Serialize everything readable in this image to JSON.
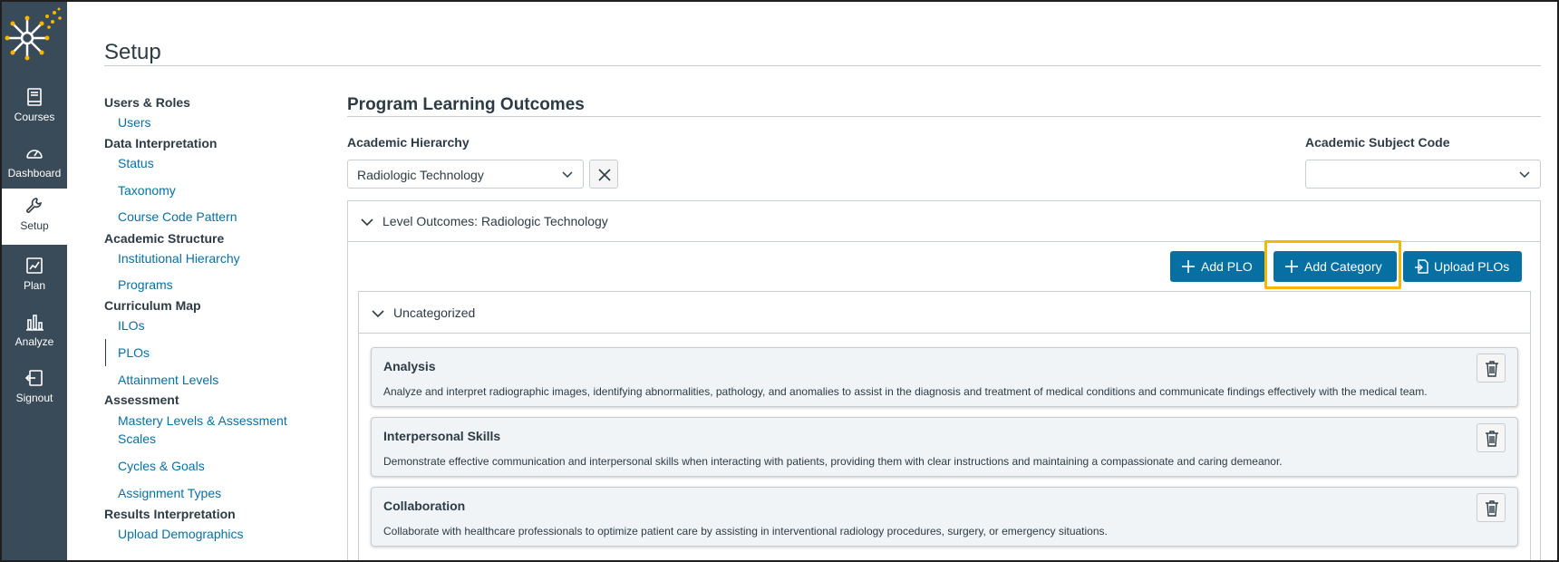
{
  "nav": {
    "items": [
      {
        "label": "Courses",
        "icon": "book-icon"
      },
      {
        "label": "Dashboard",
        "icon": "gauge-icon"
      },
      {
        "label": "Setup",
        "icon": "wrench-icon"
      },
      {
        "label": "Plan",
        "icon": "plan-icon"
      },
      {
        "label": "Analyze",
        "icon": "bar-chart-icon"
      },
      {
        "label": "Signout",
        "icon": "signout-icon"
      }
    ],
    "active": "Setup"
  },
  "page": {
    "title": "Setup"
  },
  "setup_menu": {
    "users_roles": "Users & Roles",
    "users": "Users",
    "data_interpretation": "Data Interpretation",
    "status": "Status",
    "taxonomy": "Taxonomy",
    "course_code_pattern": "Course Code Pattern",
    "academic_structure": "Academic Structure",
    "institutional_hierarchy": "Institutional Hierarchy",
    "programs": "Programs",
    "curriculum_map": "Curriculum Map",
    "ilos": "ILOs",
    "plos": "PLOs",
    "attainment_levels": "Attainment Levels",
    "assessment": "Assessment",
    "mastery_line1": "Mastery Levels & Assessment",
    "mastery_line2": "Scales",
    "cycles_goals": "Cycles & Goals",
    "assignment_types": "Assignment Types",
    "results_interpretation": "Results Interpretation",
    "upload_demographics": "Upload Demographics"
  },
  "main": {
    "title": "Program Learning Outcomes",
    "academic_hierarchy_label": "Academic Hierarchy",
    "academic_hierarchy_value": "Radiologic Technology",
    "academic_subject_code_label": "Academic Subject Code",
    "academic_subject_code_value": "",
    "level_outcomes_title": "Level Outcomes: Radiologic Technology",
    "add_plo": "Add PLO",
    "add_category": "Add Category",
    "upload_plos": "Upload PLOs",
    "uncategorized": "Uncategorized",
    "outcomes": [
      {
        "title": "Analysis",
        "description": "Analyze and interpret radiographic images, identifying abnormalities, pathology, and anomalies to assist in the diagnosis and treatment of medical conditions and communicate findings effectively with the medical team."
      },
      {
        "title": "Interpersonal Skills",
        "description": "Demonstrate effective communication and interpersonal skills when interacting with patients, providing them with clear instructions and maintaining a compassionate and caring demeanor."
      },
      {
        "title": "Collaboration",
        "description": "Collaborate with healthcare professionals to optimize patient care by assisting in interventional radiology procedures, surgery, or emergency situations."
      }
    ]
  },
  "colors": {
    "nav_bg": "#394b58",
    "primary": "#0770a3",
    "highlight": "#f5b700",
    "logo": "#f5b700"
  }
}
